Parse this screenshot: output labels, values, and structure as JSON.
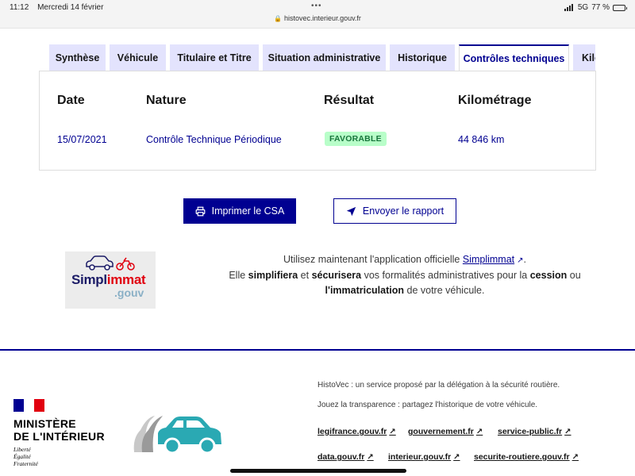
{
  "status_bar": {
    "time": "11:12",
    "date": "Mercredi 14 février",
    "dots": "•••",
    "url": "histovec.interieur.gouv.fr",
    "network": "5G",
    "battery": "77 %",
    "battery_level": 0.77
  },
  "tabs": [
    {
      "label": "Synthèse",
      "active": false
    },
    {
      "label": "Véhicule",
      "active": false
    },
    {
      "label": "Titulaire et Titre",
      "active": false
    },
    {
      "label": "Situation administrative",
      "active": false
    },
    {
      "label": "Historique",
      "active": false
    },
    {
      "label": "Contrôles techniques",
      "active": true
    },
    {
      "label": "Kilo",
      "active": false
    }
  ],
  "table": {
    "headers": {
      "date": "Date",
      "nature": "Nature",
      "resultat": "Résultat",
      "kilometrage": "Kilométrage"
    },
    "rows": [
      {
        "date": "15/07/2021",
        "nature": "Contrôle Technique Périodique",
        "resultat": "FAVORABLE",
        "kilometrage": "44 846 km"
      }
    ]
  },
  "buttons": {
    "print": "Imprimer le CSA",
    "send": "Envoyer le rapport"
  },
  "simplimmat": {
    "logo_word_1": "Simpl",
    "logo_word_2": "immat",
    "logo_gouv": ".gouv",
    "line1_before": "Utilisez maintenant l'application officielle ",
    "line1_link": "Simplimmat",
    "line1_after": ".",
    "line2_a": "Elle ",
    "line2_b": "simplifiera",
    "line2_c": " et ",
    "line2_d": "sécurisera",
    "line2_e": " vos formalités administratives pour la ",
    "line2_f": "cession",
    "line2_g": " ou",
    "line3_a": "l'immatriculation",
    "line3_b": " de votre véhicule."
  },
  "footer": {
    "ministere_line1": "MINISTÈRE",
    "ministere_line2": "DE L'INTÉRIEUR",
    "devise": [
      "Liberté",
      "Égalité",
      "Fraternité"
    ],
    "desc1": "HistoVec : un service proposé par la délégation à la sécurité routière.",
    "desc2": "Jouez la transparence : partagez l'historique de votre véhicule.",
    "links_row1": [
      "legifrance.gouv.fr",
      "gouvernement.fr",
      "service-public.fr"
    ],
    "links_row2": [
      "data.gouv.fr",
      "interieur.gouv.fr",
      "securite-routiere.gouv.fr"
    ]
  },
  "colors": {
    "primary": "#000091",
    "tab_bg": "#e3e3fd",
    "success_bg": "#b8fec9",
    "success_text": "#18753c",
    "marianne_red": "#e1000f",
    "car_teal": "#2aa9b3"
  }
}
